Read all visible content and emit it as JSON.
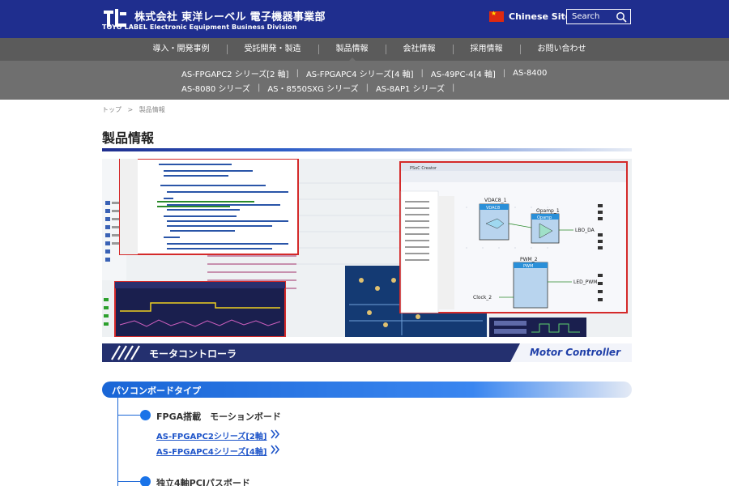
{
  "header": {
    "company_ja": "株式会社 東洋レーベル 電子機器事業部",
    "company_en": "TOYO LABEL Electronic Equipment Business Division",
    "china_site_label": "Chinese Site",
    "search_placeholder": "Search",
    "brand_color": "#1f2e8e"
  },
  "main_nav": {
    "items": [
      {
        "label": "導入・開発事例"
      },
      {
        "label": "受託開発・製造"
      },
      {
        "label": "製品情報"
      },
      {
        "label": "会社情報"
      },
      {
        "label": "採用情報"
      },
      {
        "label": "お問い合わせ"
      }
    ],
    "active_index": 2
  },
  "sub_nav": {
    "row1": [
      "AS-FPGAPC2 シリーズ[2 軸]",
      "AS-FPGAPC4 シリーズ[4 軸]",
      "AS-49PC-4[4 軸]",
      "AS-8400"
    ],
    "row2": [
      "AS-8080 シリーズ",
      "AS・8550SXG シリーズ",
      "AS-8AP1 シリーズ"
    ]
  },
  "breadcrumb": {
    "home": "トップ",
    "separator": ">",
    "current": "製品情報"
  },
  "page_title": "製品情報",
  "category_banner": {
    "title_ja": "モータコントローラ",
    "title_en": "Motor Controller"
  },
  "section": {
    "title": "パソコンボードタイプ",
    "groups": [
      {
        "label": "FPGA搭載　モーションボード",
        "links": [
          "AS-FPGAPC2シリーズ[2軸]",
          "AS-FPGAPC4シリーズ[4軸]"
        ]
      },
      {
        "label": "独立4軸PCIパスボード",
        "links": []
      }
    ]
  },
  "hero": {
    "schematic_labels": {
      "vdac": "VDAC8_1",
      "vdac_inner": "VDAC8",
      "opamp": "Opamp_1",
      "opamp_inner": "Opamp",
      "pwm": "PWM_2",
      "pwm_inner": "PWM",
      "lbo": "LBO_DA",
      "led_pwm": "LED_PWM",
      "clock": "Clock_2",
      "app_title": "PSoC Creator"
    }
  }
}
